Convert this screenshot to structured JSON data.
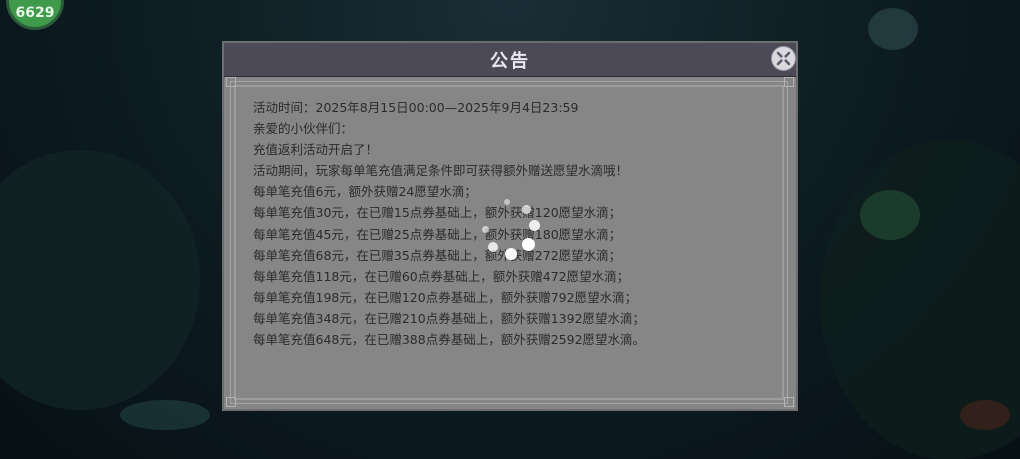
{
  "hud": {
    "badge_value": "6629"
  },
  "dialog": {
    "title": "公告",
    "close_icon": "close-x-icon",
    "lines": [
      "活动时间：2025年8月15日00:00—2025年9月4日23:59",
      "亲爱的小伙伴们：",
      "充值返利活动开启了！",
      "活动期间，玩家每单笔充值满足条件即可获得额外赠送愿望水滴哦！",
      "每单笔充值6元，额外获赠24愿望水滴；",
      "每单笔充值30元，在已赠15点券基础上，额外获赠120愿望水滴；",
      "每单笔充值45元，在已赠25点券基础上，额外获赠180愿望水滴；",
      "每单笔充值68元，在已赠35点券基础上，额外获赠272愿望水滴；",
      "每单笔充值118元，在已赠60点券基础上，额外获赠472愿望水滴；",
      "每单笔充值198元，在已赠120点券基础上，额外获赠792愿望水滴；",
      "每单笔充值348元，在已赠210点券基础上，额外获赠1392愿望水滴；",
      "每单笔充值648元，在已赠388点券基础上，额外获赠2592愿望水滴。"
    ]
  },
  "loading": {
    "icon": "loading-spinner-icon"
  },
  "colors": {
    "header": "#4b4a56",
    "panel": "#868686",
    "badge": "#3f9a4c"
  }
}
